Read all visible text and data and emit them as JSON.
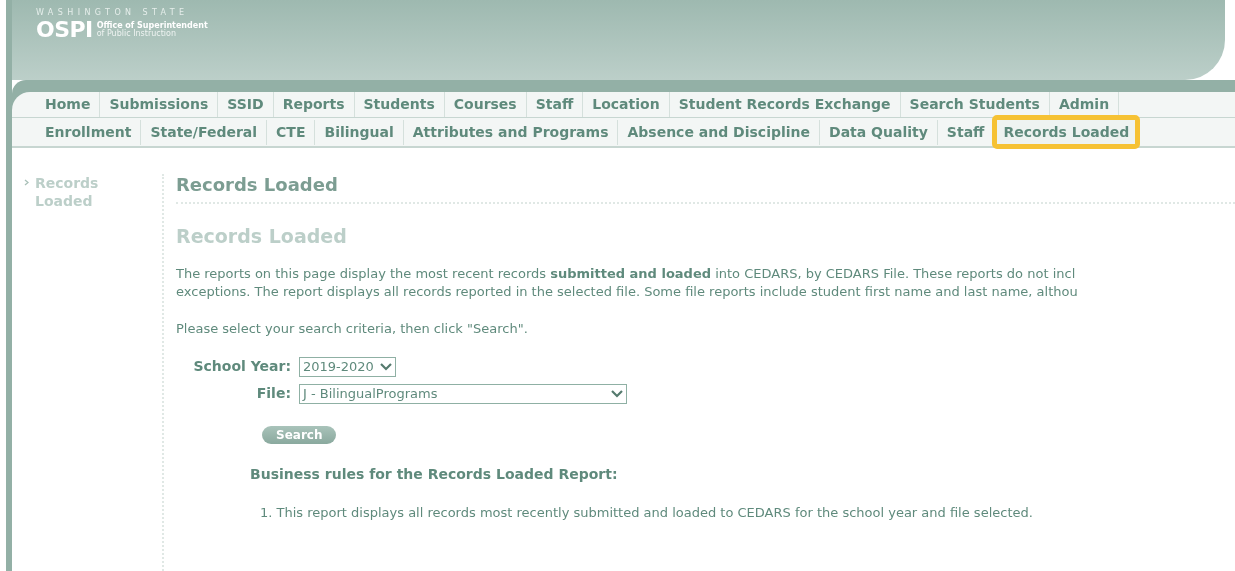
{
  "logo": {
    "state": "WASHINGTON STATE",
    "mark": "OSPI",
    "line_1": "Office of Superintendent",
    "line_2": "of Public Instruction"
  },
  "main_tabs": [
    {
      "label": "Home"
    },
    {
      "label": "Submissions"
    },
    {
      "label": "SSID"
    },
    {
      "label": "Reports"
    },
    {
      "label": "Students"
    },
    {
      "label": "Courses"
    },
    {
      "label": "Staff"
    },
    {
      "label": "Location"
    },
    {
      "label": "Student Records Exchange"
    },
    {
      "label": "Search Students"
    },
    {
      "label": "Admin"
    }
  ],
  "sub_tabs": [
    {
      "label": "Enrollment",
      "selected": false
    },
    {
      "label": "State/Federal",
      "selected": false
    },
    {
      "label": "CTE",
      "selected": false
    },
    {
      "label": "Bilingual",
      "selected": false
    },
    {
      "label": "Attributes and Programs",
      "selected": false
    },
    {
      "label": "Absence and Discipline",
      "selected": false
    },
    {
      "label": "Data Quality",
      "selected": false
    },
    {
      "label": "Staff",
      "selected": false
    },
    {
      "label": "Records Loaded",
      "selected": true
    }
  ],
  "sidebar": {
    "items": [
      {
        "label": "Records Loaded"
      }
    ]
  },
  "page_title": "Records Loaded",
  "section_title": "Records Loaded",
  "intro_lines": [
    "The reports on this page display the most recent records **submitted and loaded** into CEDARS, by CEDARS File. These reports do not incl",
    "exceptions. The report displays all records reported in the selected file. Some file reports include student first name and last name, althou"
  ],
  "instruction": "Please select your search criteria, then click \"Search\".",
  "form": {
    "school_year": {
      "label": "School Year:",
      "value": "2019-2020"
    },
    "file": {
      "label": "File:",
      "value": "J - BilingualPrograms"
    },
    "search_button": "Search"
  },
  "rules": {
    "title": "Business rules for the Records Loaded Report:",
    "items": [
      "1. This report displays all records most recently submitted and loaded to CEDARS for the school year and file selected."
    ]
  }
}
